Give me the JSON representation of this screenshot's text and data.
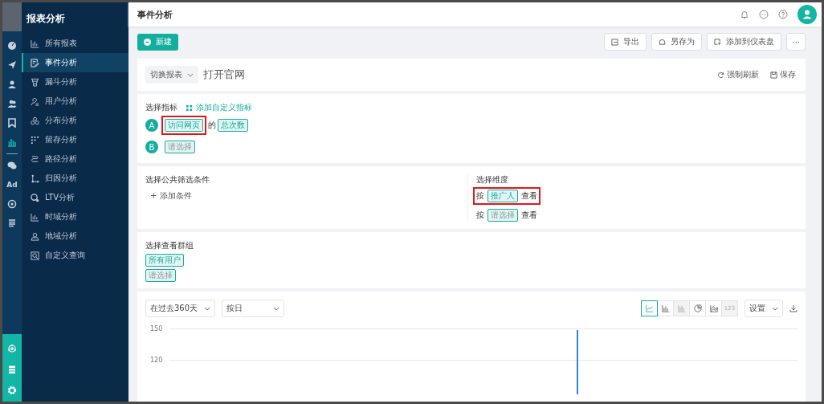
{
  "rail": [
    {
      "kind": "icon",
      "selected": false
    },
    {
      "kind": "icon",
      "selected": false
    },
    {
      "kind": "icon",
      "selected": false
    },
    {
      "kind": "icon",
      "selected": false
    },
    {
      "kind": "icon",
      "selected": false
    },
    {
      "kind": "icon",
      "selected": true
    },
    {
      "kind": "icon",
      "selected": false
    },
    {
      "kind": "text",
      "label": "Ad",
      "selected": false
    },
    {
      "kind": "icon",
      "selected": false
    },
    {
      "kind": "icon",
      "selected": false
    }
  ],
  "sidebar": {
    "title": "报表分析",
    "items": [
      {
        "label": "所有报表",
        "selected": false
      },
      {
        "label": "事件分析",
        "selected": true
      },
      {
        "label": "漏斗分析",
        "selected": false
      },
      {
        "label": "用户分析",
        "selected": false
      },
      {
        "label": "分布分析",
        "selected": false
      },
      {
        "label": "留存分析",
        "selected": false
      },
      {
        "label": "路径分析",
        "selected": false
      },
      {
        "label": "归因分析",
        "selected": false
      },
      {
        "label": "LTV分析",
        "selected": false
      },
      {
        "label": "时域分析",
        "selected": false
      },
      {
        "label": "地域分析",
        "selected": false
      },
      {
        "label": "自定义查询",
        "selected": false
      }
    ]
  },
  "header": {
    "title": "事件分析"
  },
  "toolbar": {
    "new_button": "新建",
    "actions": [
      {
        "label": "导出"
      },
      {
        "label": "另存为"
      },
      {
        "label": "添加到仪表盘"
      }
    ],
    "more": "···"
  },
  "report": {
    "switch_label": "切换报表",
    "name": "打开官网",
    "refresh": "强制刷新",
    "save": "保存"
  },
  "metrics": {
    "title": "选择指标",
    "add_custom": "添加自定义指标",
    "rows": [
      {
        "badge": "A",
        "event": "访问网页",
        "event_highlighted": true,
        "joiner": "的",
        "measure": "总次数",
        "placeholder": false
      },
      {
        "badge": "B",
        "event": "请选择",
        "event_highlighted": false,
        "placeholder": true
      }
    ]
  },
  "filters": {
    "title": "选择公共筛选条件",
    "add": "+ 添加条件"
  },
  "dimensions": {
    "title": "选择维度",
    "rows": [
      {
        "prefix": "按",
        "value": "推广人",
        "suffix": "查看",
        "highlighted": true,
        "placeholder": false
      },
      {
        "prefix": "按",
        "value": "请选择",
        "suffix": "查看",
        "highlighted": false,
        "placeholder": true
      }
    ]
  },
  "groups": {
    "title": "选择查看群组",
    "items": [
      {
        "label": "所有用户",
        "placeholder": false
      },
      {
        "label": "请选择",
        "placeholder": true
      }
    ]
  },
  "chart_panel": {
    "range": "在过去360天",
    "granularity": "按日",
    "chart_types": [
      {
        "kind": "line",
        "selected": true,
        "disabled": false
      },
      {
        "kind": "bar",
        "selected": false,
        "disabled": false
      },
      {
        "kind": "stacked",
        "selected": false,
        "disabled": true
      },
      {
        "kind": "pie",
        "selected": false,
        "disabled": false
      },
      {
        "kind": "area",
        "selected": false,
        "disabled": false
      },
      {
        "kind": "number",
        "label": "123",
        "selected": false,
        "disabled": true
      }
    ],
    "settings": "设置",
    "ytick_labels": [
      "150",
      "120"
    ]
  }
}
